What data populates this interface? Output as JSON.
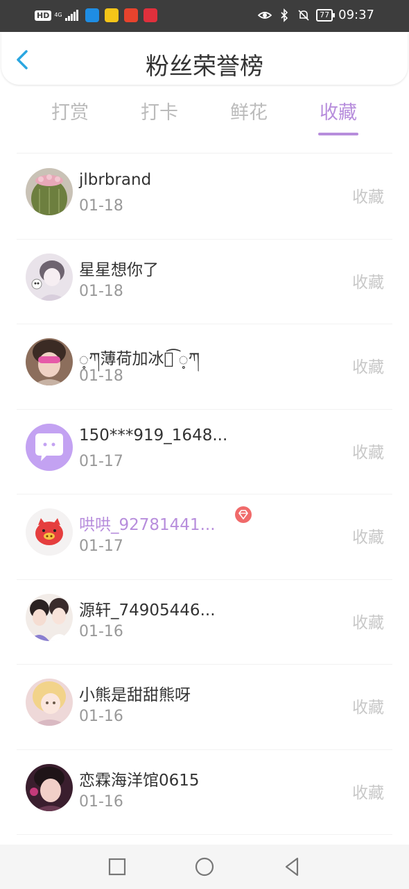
{
  "status_bar": {
    "hd": "HD",
    "network": "4G",
    "battery": "77",
    "time": "09:37"
  },
  "header": {
    "title": "粉丝荣誉榜"
  },
  "tabs": [
    {
      "label": "打赏",
      "active": false
    },
    {
      "label": "打卡",
      "active": false
    },
    {
      "label": "鲜花",
      "active": false
    },
    {
      "label": "收藏",
      "active": true
    }
  ],
  "fans": [
    {
      "name": "jlbrbrand",
      "date": "01-18",
      "action": "收藏",
      "vip": false,
      "avatar": "cactus-avatar"
    },
    {
      "name": "星星想你了",
      "date": "01-18",
      "action": "收藏",
      "vip": false,
      "avatar": "anime-girl-avatar"
    },
    {
      "name": "့ཀ薄荷加冰ཞ͡ ့ཀ",
      "date": "01-18",
      "action": "收藏",
      "vip": false,
      "avatar": "girl-photo-avatar"
    },
    {
      "name": "150***919_1648...",
      "date": "01-17",
      "action": "收藏",
      "vip": false,
      "avatar": "chat-bubble-avatar"
    },
    {
      "name": "哄哄_92781441...",
      "date": "01-17",
      "action": "收藏",
      "vip": true,
      "avatar": "pig-avatar"
    },
    {
      "name": "源轩_74905446...",
      "date": "01-16",
      "action": "收藏",
      "vip": false,
      "avatar": "couple-avatar"
    },
    {
      "name": "小熊是甜甜熊呀",
      "date": "01-16",
      "action": "收藏",
      "vip": false,
      "avatar": "anime-blonde-avatar"
    },
    {
      "name": "恋霖海洋馆0615",
      "date": "01-16",
      "action": "收藏",
      "vip": false,
      "avatar": "boy-photo-avatar"
    }
  ],
  "colors": {
    "accent": "#b78ddc",
    "back_arrow": "#2aa6e0"
  }
}
